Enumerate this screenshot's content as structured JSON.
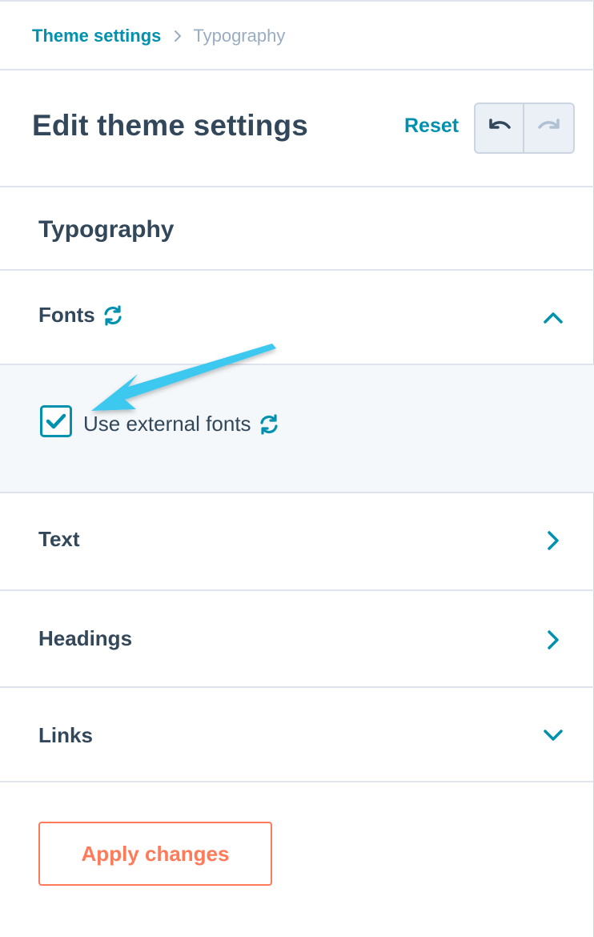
{
  "breadcrumb": {
    "parent": "Theme settings",
    "current": "Typography"
  },
  "header": {
    "title": "Edit theme settings",
    "reset_label": "Reset",
    "undo_icon": "undo-icon",
    "redo_icon": "redo-icon"
  },
  "section": {
    "title": "Typography"
  },
  "accordion": {
    "fonts": {
      "label": "Fonts",
      "expanded": true,
      "icon": "chevron-up-icon"
    },
    "text": {
      "label": "Text",
      "expanded": false,
      "icon": "chevron-right-icon"
    },
    "headings": {
      "label": "Headings",
      "expanded": false,
      "icon": "chevron-right-icon"
    },
    "links": {
      "label": "Links",
      "expanded": false,
      "icon": "chevron-down-icon"
    }
  },
  "fonts_panel": {
    "checkbox_label": "Use external fonts",
    "checked": true
  },
  "footer": {
    "apply_label": "Apply changes"
  },
  "colors": {
    "accent": "#0091ae",
    "text": "#33475b",
    "muted": "#99acc2",
    "cta": "#ff7a59",
    "annotation_arrow": "#3cc8f0",
    "panel_bg": "#f5f8fa"
  }
}
